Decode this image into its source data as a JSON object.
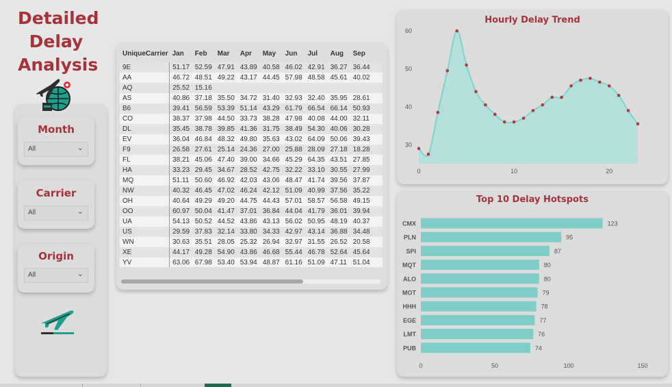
{
  "title": "Detailed Delay Analysis",
  "title_lines": [
    "Detailed",
    "Delay",
    "Analysis"
  ],
  "icons": {
    "top": "airplane-globe-icon",
    "bottom": "airplane-takeoff-icon"
  },
  "slicers": [
    {
      "label": "Month",
      "value": "All"
    },
    {
      "label": "Carrier",
      "value": "All"
    },
    {
      "label": "Origin",
      "value": "All"
    }
  ],
  "matrix": {
    "columns": [
      "UniqueCarrier",
      "Jan",
      "Feb",
      "Mar",
      "Apr",
      "May",
      "Jun",
      "Jul",
      "Aug",
      "Sep"
    ],
    "rows": [
      [
        "9E",
        "51.17",
        "52.59",
        "47.91",
        "43.89",
        "40.58",
        "46.02",
        "42.91",
        "36.27",
        "36.44"
      ],
      [
        "AA",
        "46.72",
        "48.51",
        "49.22",
        "43.17",
        "44.45",
        "57.98",
        "48.58",
        "45.61",
        "40.02"
      ],
      [
        "AQ",
        "25.52",
        "15.16",
        "",
        "",
        "",
        "",
        "",
        "",
        ""
      ],
      [
        "AS",
        "40.86",
        "37.18",
        "35.50",
        "34.72",
        "31.40",
        "32.93",
        "32.40",
        "35.95",
        "28.61"
      ],
      [
        "B6",
        "39.41",
        "56.59",
        "53.39",
        "51.14",
        "43.29",
        "61.79",
        "66.54",
        "66.14",
        "50.93"
      ],
      [
        "CO",
        "38.37",
        "37.98",
        "44.50",
        "33.73",
        "38.28",
        "47.98",
        "40.08",
        "44.00",
        "32.11"
      ],
      [
        "DL",
        "35.45",
        "38.78",
        "39.85",
        "41.36",
        "31.75",
        "38.49",
        "54.30",
        "40.06",
        "30.28"
      ],
      [
        "EV",
        "36.04",
        "46.84",
        "48.32",
        "49.80",
        "35.63",
        "43.02",
        "64.09",
        "50.06",
        "39.43"
      ],
      [
        "F9",
        "26.58",
        "27.61",
        "25.14",
        "24.36",
        "27.00",
        "25.88",
        "28.09",
        "27.18",
        "18.28"
      ],
      [
        "FL",
        "38.21",
        "45.06",
        "47.40",
        "39.00",
        "34.66",
        "45.29",
        "64.35",
        "43.51",
        "27.85"
      ],
      [
        "HA",
        "33.23",
        "29.45",
        "34.67",
        "28.52",
        "42.75",
        "32.22",
        "33.10",
        "30.55",
        "27.99"
      ],
      [
        "MQ",
        "51.11",
        "50.60",
        "46.92",
        "42.03",
        "43.06",
        "48.47",
        "41.74",
        "39.56",
        "37.87"
      ],
      [
        "NW",
        "40.32",
        "46.45",
        "47.02",
        "46.24",
        "42.12",
        "51.09",
        "40.99",
        "37.56",
        "35.22"
      ],
      [
        "OH",
        "40.64",
        "49.29",
        "49.20",
        "44.75",
        "44.43",
        "57.01",
        "58.57",
        "56.58",
        "49.15"
      ],
      [
        "OO",
        "60.97",
        "50.04",
        "41.47",
        "37.01",
        "36.84",
        "44.04",
        "41.79",
        "36.01",
        "39.94"
      ],
      [
        "UA",
        "54.13",
        "50.52",
        "44.52",
        "43.86",
        "43.13",
        "56.02",
        "50.95",
        "48.19",
        "40.37"
      ],
      [
        "US",
        "29.59",
        "37.83",
        "32.14",
        "33.80",
        "34.33",
        "42.97",
        "43.14",
        "36.88",
        "34.48"
      ],
      [
        "WN",
        "30.63",
        "35.51",
        "28.05",
        "25.32",
        "26.94",
        "32.97",
        "31.55",
        "26.52",
        "20.58"
      ],
      [
        "XE",
        "44.17",
        "49.28",
        "54.90",
        "43.86",
        "46.68",
        "55.44",
        "46.78",
        "52.64",
        "45.64"
      ],
      [
        "YV",
        "63.06",
        "67.98",
        "53.40",
        "53.94",
        "48.87",
        "61.16",
        "51.09",
        "47.11",
        "51.04"
      ]
    ]
  },
  "colors": {
    "accent": "#a4343a",
    "area_fill": "#b4dfda",
    "area_line": "#7ed3cd",
    "point": "#b0383f",
    "bar": "#7ecdc7"
  },
  "chart_data": [
    {
      "type": "area",
      "title": "Hourly Delay Trend",
      "xlabel": "",
      "ylabel": "",
      "x": [
        0,
        1,
        2,
        3,
        4,
        5,
        6,
        7,
        8,
        9,
        10,
        11,
        12,
        13,
        14,
        15,
        16,
        17,
        18,
        19,
        20,
        21,
        22,
        23
      ],
      "values": [
        29,
        27.5,
        38.5,
        49.5,
        60,
        51,
        44,
        40.5,
        38,
        36,
        36,
        37,
        39,
        40.5,
        42.5,
        42.5,
        45.5,
        47,
        47.5,
        46.5,
        45.5,
        43,
        39,
        35.5
      ],
      "xlim": [
        0,
        23
      ],
      "ylim": [
        25,
        62
      ],
      "xticks": [
        0,
        10,
        20
      ],
      "yticks": [
        30,
        40,
        50,
        60
      ],
      "grid": false,
      "legend": "none"
    },
    {
      "type": "bar",
      "orientation": "horizontal",
      "title": "Top 10 Delay Hotspots",
      "xlabel": "",
      "ylabel": "",
      "categories": [
        "CMX",
        "PLN",
        "SPI",
        "MQT",
        "ALO",
        "MOT",
        "HHH",
        "EGE",
        "LMT",
        "PUB"
      ],
      "values": [
        123,
        95,
        87,
        80,
        80,
        79,
        78,
        77,
        76,
        74
      ],
      "xlim": [
        0,
        150
      ],
      "xticks": [
        0,
        50,
        100,
        150
      ],
      "grid": false,
      "legend": "none"
    }
  ]
}
